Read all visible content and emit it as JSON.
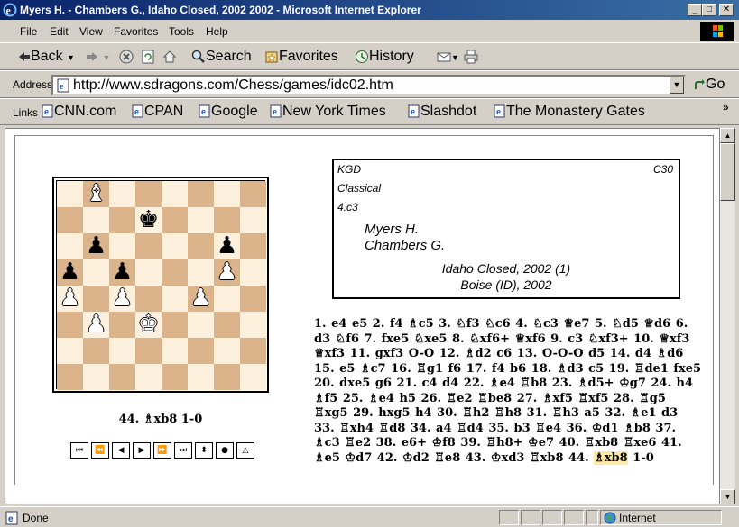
{
  "window": {
    "title": "Myers H. - Chambers G., Idaho Closed, 2002 2002 - Microsoft Internet Explorer",
    "min": "_",
    "max": "□",
    "close": "✕"
  },
  "menu": [
    "File",
    "Edit",
    "View",
    "Favorites",
    "Tools",
    "Help"
  ],
  "toolbar": {
    "back": "Back",
    "search": "Search",
    "favorites": "Favorites",
    "history": "History"
  },
  "address": {
    "label": "Address",
    "url": "http://www.sdragons.com/Chess/games/idc02.htm",
    "go": "Go"
  },
  "links": {
    "label": "Links",
    "items": [
      "CNN.com",
      "CPAN",
      "Google",
      "New York Times",
      "Slashdot",
      "The Monastery Gates"
    ],
    "more": "»"
  },
  "game": {
    "opening": "KGD",
    "eco": "C30",
    "variation": "Classical",
    "subvariation": "4.c3",
    "white": "Myers H.",
    "black": "Chambers G.",
    "event": "Idaho Closed, 2002 (1)",
    "site": "Boise (ID), 2002",
    "current_move": "44. ♗xb8 1-0",
    "moves_before": "1. e4 e5 2. f4 ♗c5 3. ♘f3 ♘c6 4. ♘c3 ♕e7 5. ♘d5 ♕d6 6. d3 ♘f6 7. fxe5 ♘xe5 8. ♘xf6+ ♕xf6 9. c3 ♘xf3+ 10. ♕xf3 ♕xf3 11. gxf3 O-O 12. ♗d2 c6 13. O-O-O d5 14. d4 ♗d6 15. e5 ♗c7 16. ♖g1 f6 17. f4 b6 18. ♗d3 c5 19. ♖de1 fxe5 20. dxe5 g6 21. c4 d4 22. ♗e4 ♖b8 23. ♗d5+ ♔g7 24. h4 ♗f5 25. ♗e4 h5 26. ♖e2 ♖be8 27. ♗xf5 ♖xf5 28. ♖g5 ♖xg5 29. hxg5 h4 30. ♖h2 ♖h8 31. ♖h3 a5 32. ♗e1 d3 33. ♖xh4 ♖d8 34. a4 ♖d4 35. b3 ♖e4 36. ♔d1 ♗b8 37. ♗c3 ♖e2 38. e6+ ♔f8 39. ♖h8+ ♔e7 40. ♖xb8 ♖xe6 41. ♗e5 ♔d7 42. ♔d2 ♖e8 43. ♔xd3 ♖xb8 44. ",
    "moves_current": "♗xb8",
    "moves_after": " 1-0"
  },
  "board": {
    "light_color": "#fdf0dc",
    "dark_color": "#dcb48c",
    "pieces": [
      {
        "square": "b8",
        "piece": "♝",
        "side": "w",
        "name": "white-bishop-b8"
      },
      {
        "square": "d7",
        "piece": "♚",
        "side": "b",
        "name": "black-king-d7"
      },
      {
        "square": "b6",
        "piece": "♟",
        "side": "b",
        "name": "black-pawn-b6"
      },
      {
        "square": "g6",
        "piece": "♟",
        "side": "b",
        "name": "black-pawn-g6"
      },
      {
        "square": "a5",
        "piece": "♟",
        "side": "b",
        "name": "black-pawn-a5"
      },
      {
        "square": "c5",
        "piece": "♟",
        "side": "b",
        "name": "black-pawn-c5"
      },
      {
        "square": "g5",
        "piece": "♟",
        "side": "w",
        "name": "white-pawn-g5"
      },
      {
        "square": "a4",
        "piece": "♟",
        "side": "w",
        "name": "white-pawn-a4"
      },
      {
        "square": "c4",
        "piece": "♟",
        "side": "w",
        "name": "white-pawn-c4"
      },
      {
        "square": "f4",
        "piece": "♟",
        "side": "w",
        "name": "white-pawn-f4"
      },
      {
        "square": "b3",
        "piece": "♟",
        "side": "w",
        "name": "white-pawn-b3"
      },
      {
        "square": "d3",
        "piece": "♚",
        "side": "w",
        "name": "white-king-d3"
      }
    ]
  },
  "controls": [
    "⏮",
    "⏪",
    "◀",
    "▶",
    "⏩",
    "⏭",
    "⬍",
    "●",
    "△"
  ],
  "status": {
    "text": "Done",
    "zone": "Internet"
  }
}
